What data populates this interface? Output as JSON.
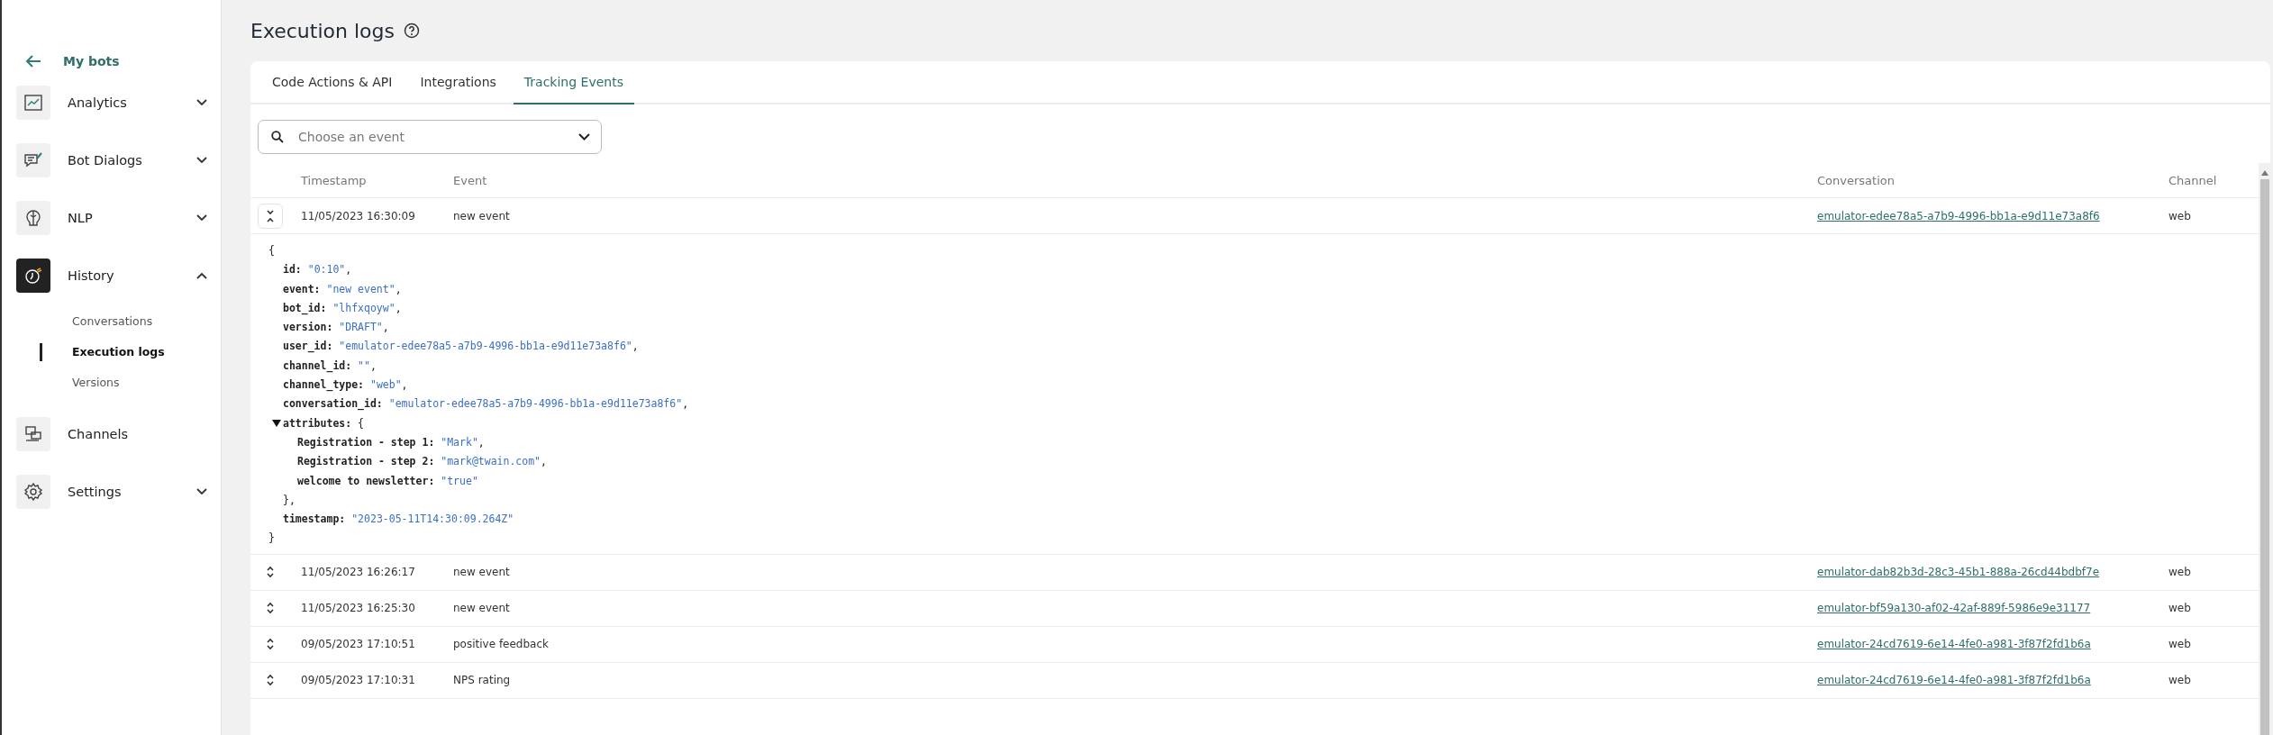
{
  "sidebar": {
    "back": {
      "label": "My bots"
    },
    "items": [
      {
        "label": "Analytics",
        "kind": "menu",
        "expanded": false,
        "active": false
      },
      {
        "label": "Bot Dialogs",
        "kind": "menu",
        "expanded": false,
        "active": false
      },
      {
        "label": "NLP",
        "kind": "menu",
        "expanded": false,
        "active": false
      },
      {
        "label": "History",
        "kind": "menu",
        "expanded": true,
        "active": true,
        "children": [
          {
            "label": "Conversations",
            "selected": false
          },
          {
            "label": "Execution logs",
            "selected": true
          },
          {
            "label": "Versions",
            "selected": false
          }
        ]
      },
      {
        "label": "Channels",
        "kind": "link",
        "active": false
      },
      {
        "label": "Settings",
        "kind": "menu",
        "expanded": false,
        "active": false
      }
    ]
  },
  "page": {
    "title": "Execution logs"
  },
  "tabs": [
    {
      "label": "Code Actions & API",
      "selected": false
    },
    {
      "label": "Integrations",
      "selected": false
    },
    {
      "label": "Tracking Events",
      "selected": true
    }
  ],
  "search": {
    "placeholder": "Choose an event"
  },
  "table": {
    "columns": [
      "Timestamp",
      "Event",
      "Conversation",
      "Channel"
    ],
    "rows": [
      {
        "timestamp": "11/05/2023 16:30:09",
        "event": "new event",
        "conversation": "emulator-edee78a5-a7b9-4996-bb1a-e9d11e73a8f6",
        "channel": "web",
        "expanded": true,
        "detail": {
          "open": "{",
          "close": "}",
          "fields": [
            {
              "key": "id:",
              "value": "\"0:10\"",
              "trail": ","
            },
            {
              "key": "event:",
              "value": "\"new event\"",
              "trail": ","
            },
            {
              "key": "bot_id:",
              "value": "\"lhfxqoyw\"",
              "trail": ","
            },
            {
              "key": "version:",
              "value": "\"DRAFT\"",
              "trail": ","
            },
            {
              "key": "user_id:",
              "value": "\"emulator-edee78a5-a7b9-4996-bb1a-e9d11e73a8f6\"",
              "trail": ","
            },
            {
              "key": "channel_id:",
              "value": "\"\"",
              "trail": ","
            },
            {
              "key": "channel_type:",
              "value": "\"web\"",
              "trail": ","
            },
            {
              "key": "conversation_id:",
              "value": "\"emulator-edee78a5-a7b9-4996-bb1a-e9d11e73a8f6\"",
              "trail": ","
            },
            {
              "key": "attributes:",
              "open": "{",
              "close": "},",
              "expanded": true,
              "children": [
                {
                  "key": "Registration - step 1:",
                  "value": "\"Mark\"",
                  "trail": ","
                },
                {
                  "key": "Registration - step 2:",
                  "value": "\"mark@twain.com\"",
                  "trail": ","
                },
                {
                  "key": "welcome to newsletter:",
                  "value": "\"true\""
                }
              ]
            },
            {
              "key": "timestamp:",
              "value": "\"2023-05-11T14:30:09.264Z\""
            }
          ]
        }
      },
      {
        "timestamp": "11/05/2023 16:26:17",
        "event": "new event",
        "conversation": "emulator-dab82b3d-28c3-45b1-888a-26cd44bdbf7e",
        "channel": "web",
        "expanded": false
      },
      {
        "timestamp": "11/05/2023 16:25:30",
        "event": "new event",
        "conversation": "emulator-bf59a130-af02-42af-889f-5986e9e31177",
        "channel": "web",
        "expanded": false
      },
      {
        "timestamp": "09/05/2023 17:10:51",
        "event": "positive feedback",
        "conversation": "emulator-24cd7619-6e14-4fe0-a981-3f87f2fd1b6a",
        "channel": "web",
        "expanded": false
      },
      {
        "timestamp": "09/05/2023 17:10:31",
        "event": "NPS rating",
        "conversation": "emulator-24cd7619-6e14-4fe0-a981-3f87f2fd1b6a",
        "channel": "web",
        "expanded": false
      }
    ]
  }
}
